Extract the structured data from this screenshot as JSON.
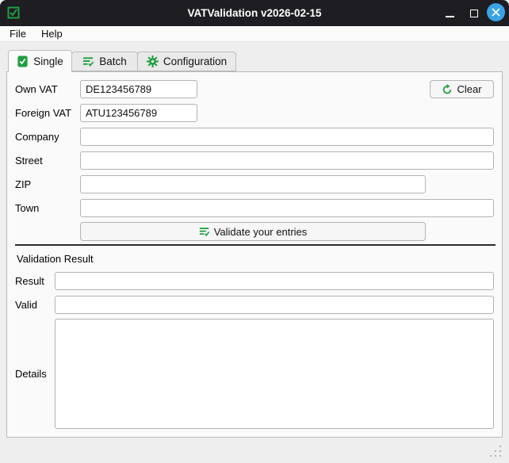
{
  "window": {
    "title": "VATValidation v2026-02-15",
    "icons": {
      "app": "checkbox-checked-icon",
      "minimize": "minimize-icon",
      "maximize": "maximize-icon",
      "close": "close-icon",
      "resize_grip": "resize-grip-icon"
    },
    "colors": {
      "titlebar_bg": "#1d1d22",
      "accent_green": "#1e9e3e",
      "close_blue": "#3aa3e3",
      "panel_bg": "#fafafa",
      "window_bg": "#eeeeee"
    }
  },
  "menubar": {
    "items": [
      {
        "label": "File"
      },
      {
        "label": "Help"
      }
    ]
  },
  "tabs": [
    {
      "label": "Single",
      "icon": "document-check-icon",
      "active": true
    },
    {
      "label": "Batch",
      "icon": "list-check-icon",
      "active": false
    },
    {
      "label": "Configuration",
      "icon": "gear-icon",
      "active": false
    }
  ],
  "form": {
    "fields": [
      {
        "label": "Own VAT",
        "value": "DE123456789"
      },
      {
        "label": "Foreign VAT",
        "value": "ATU123456789"
      },
      {
        "label": "Company",
        "value": ""
      },
      {
        "label": "Street",
        "value": ""
      },
      {
        "label": "ZIP",
        "value": ""
      },
      {
        "label": "Town",
        "value": ""
      }
    ],
    "clear_button": {
      "label": "Clear",
      "icon": "refresh-icon"
    },
    "validate_button": {
      "label": "Validate your entries",
      "icon": "list-check-icon"
    }
  },
  "result_section": {
    "heading": "Validation Result",
    "fields": [
      {
        "label": "Result",
        "value": ""
      },
      {
        "label": "Valid",
        "value": ""
      },
      {
        "label": "Details",
        "value": ""
      }
    ]
  }
}
